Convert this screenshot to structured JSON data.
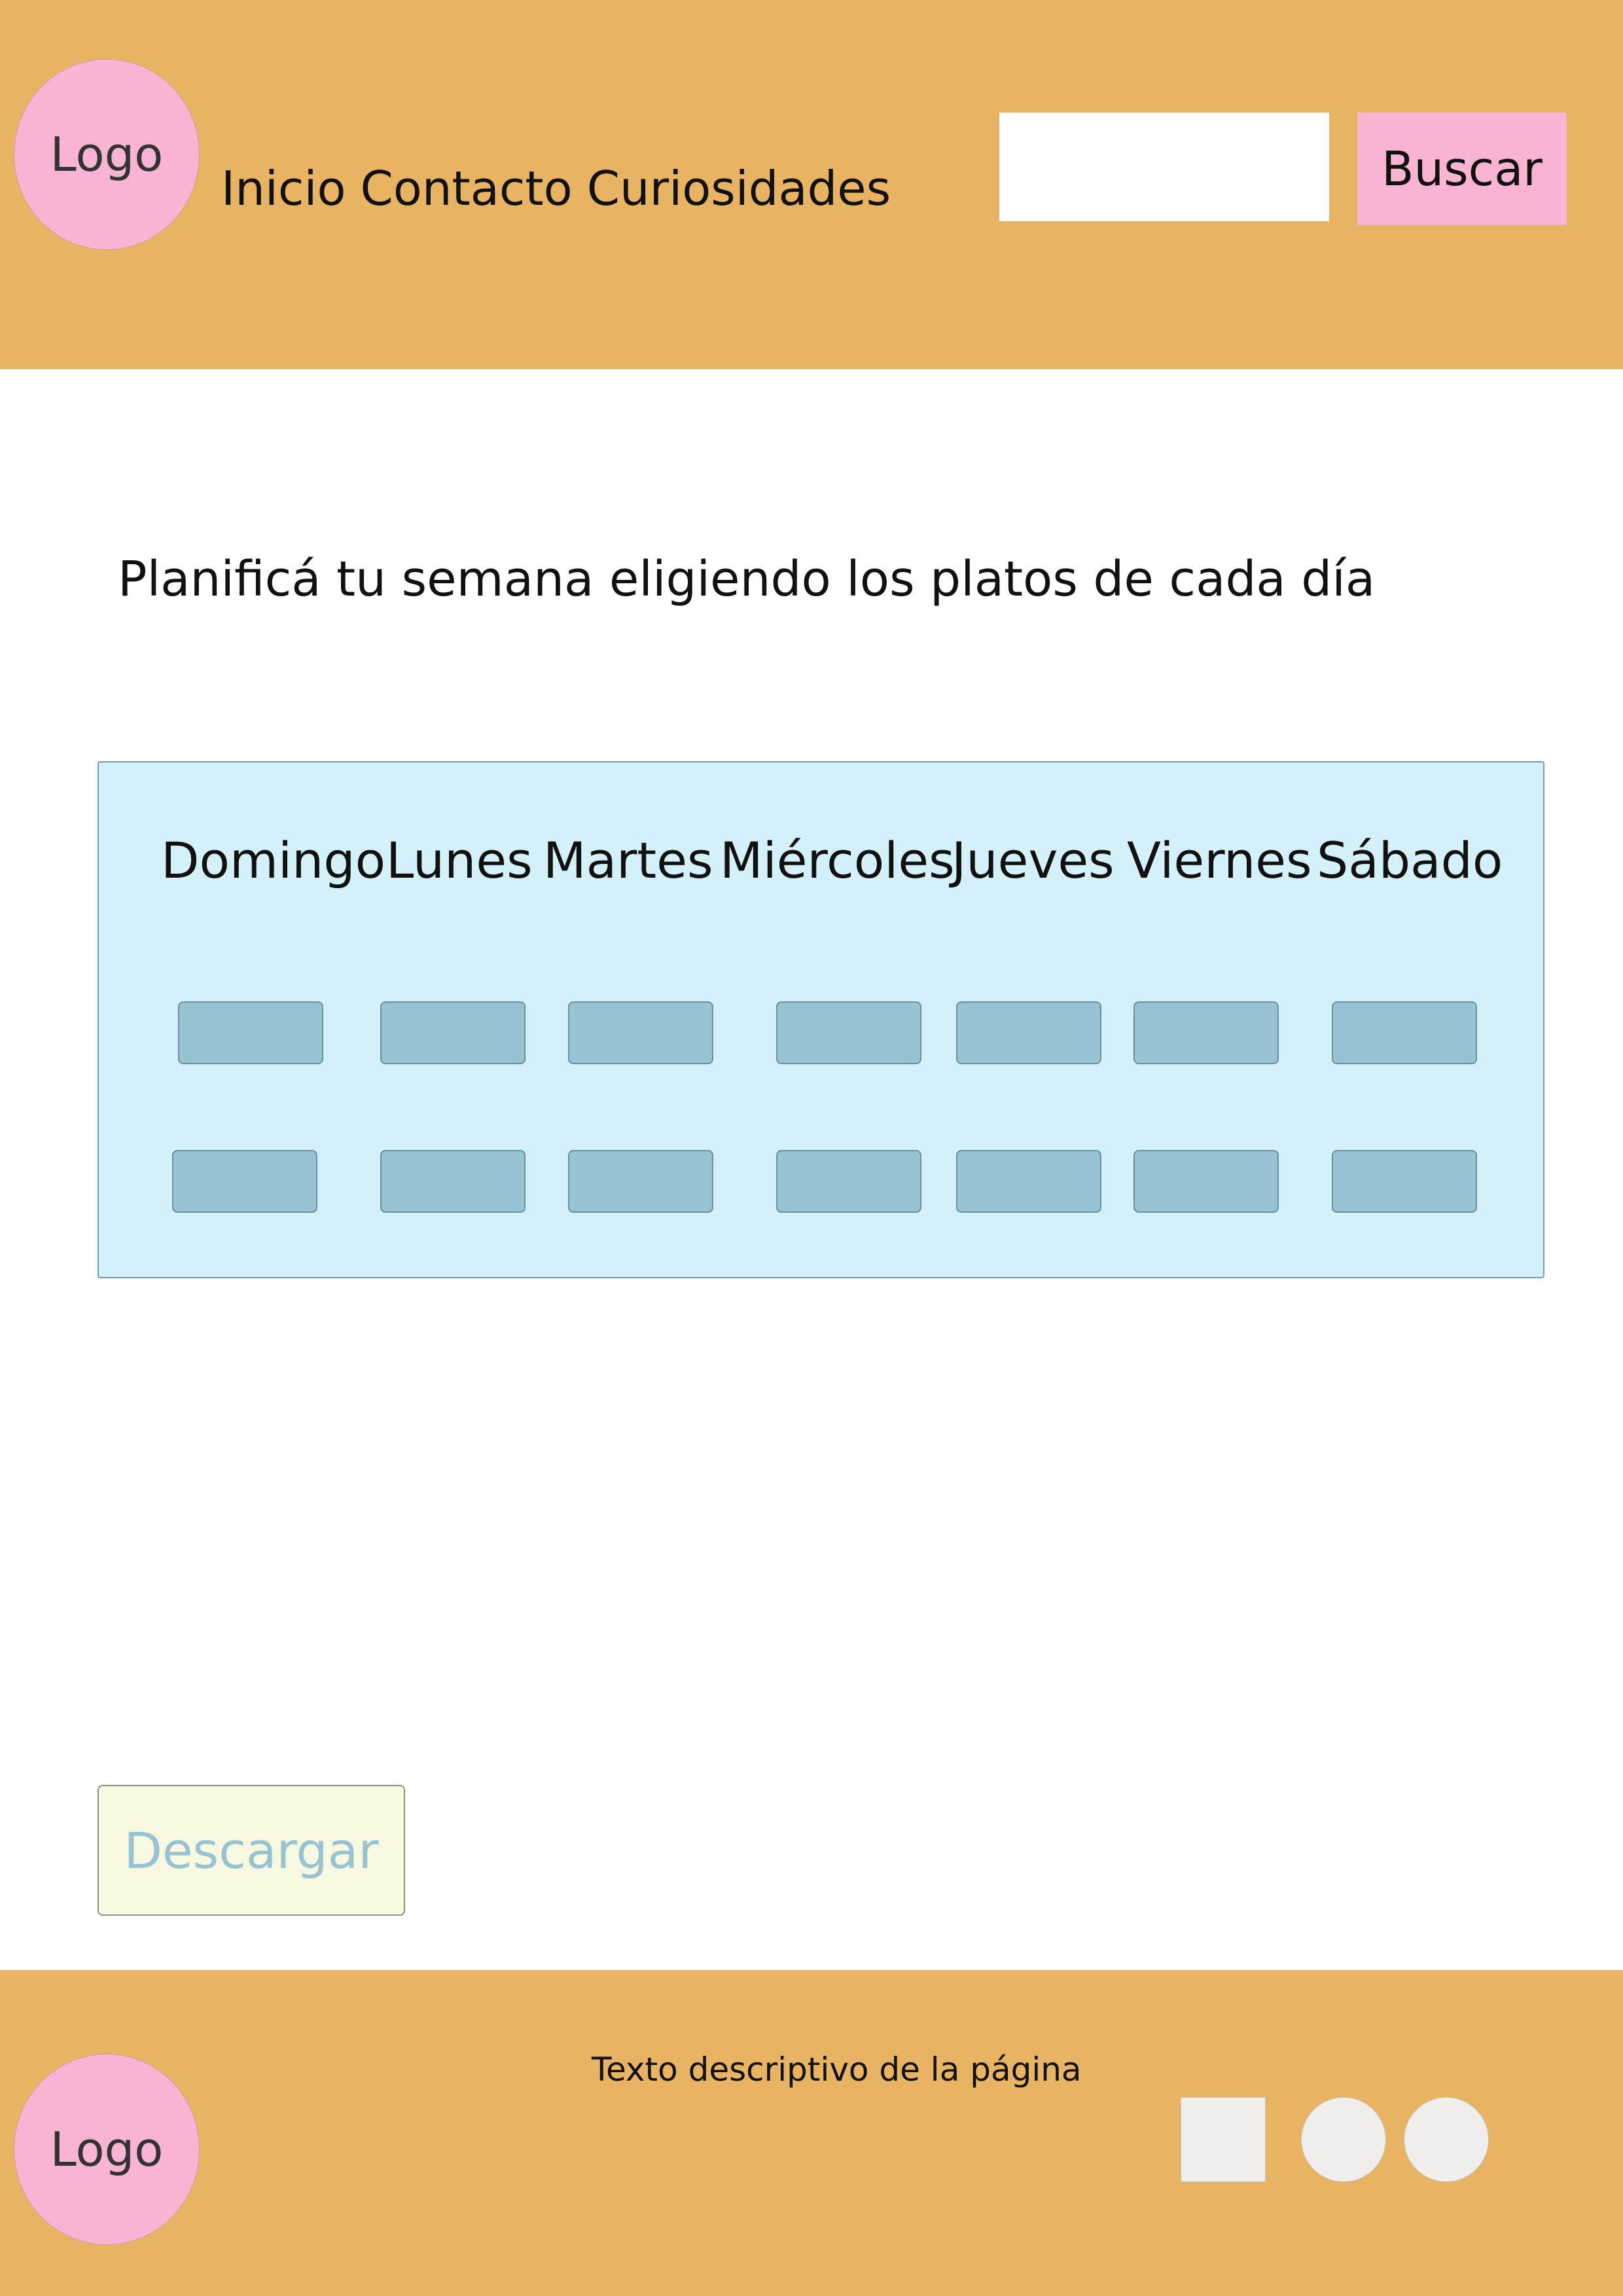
{
  "header": {
    "logo": "Logo",
    "nav": [
      "Inicio",
      "Contacto",
      "Curiosidades"
    ],
    "search": {
      "value": "",
      "placeholder": ""
    },
    "search_button": "Buscar"
  },
  "main": {
    "heading": "Planificá tu semana eligiendo los platos de cada día",
    "planner": {
      "days": [
        "Domingo",
        "Lunes",
        "Martes",
        "Miércoles",
        "Jueves",
        "Viernes",
        "Sábado"
      ]
    },
    "download_button": "Descargar"
  },
  "footer": {
    "logo": "Logo",
    "description": "Texto descriptivo de la página",
    "social_icons": [
      "social-square-icon",
      "social-circle-icon",
      "social-circle-icon"
    ]
  },
  "colors": {
    "header_bg": "#e8b464",
    "logo_bg": "#f8b4d2",
    "planner_bg": "#d4f0f9",
    "slot_bg": "#97c3d2",
    "download_bg": "#f7f8df",
    "download_text": "#97c3d2",
    "social_bg": "#f0eeeb"
  }
}
